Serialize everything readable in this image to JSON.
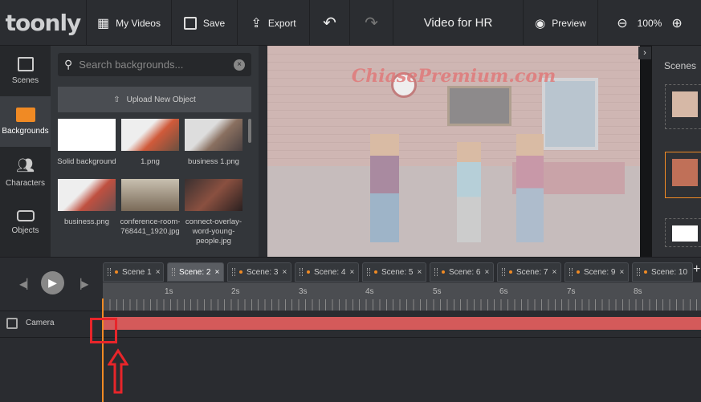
{
  "topbar": {
    "logo": "toonly",
    "my_videos": "My Videos",
    "save": "Save",
    "export": "Export",
    "title": "Video for HR",
    "preview": "Preview",
    "zoom": "100%"
  },
  "sidebar": {
    "items": [
      {
        "label": "Scenes",
        "icon": "scenes-icon"
      },
      {
        "label": "Backgrounds",
        "icon": "backgrounds-icon",
        "active": true
      },
      {
        "label": "Characters",
        "icon": "characters-icon"
      },
      {
        "label": "Objects",
        "icon": "objects-icon"
      }
    ]
  },
  "panel": {
    "search_placeholder": "Search backgrounds...",
    "upload": "Upload New Object",
    "items": [
      {
        "label": "Solid background"
      },
      {
        "label": "1.png"
      },
      {
        "label": "business 1.png"
      },
      {
        "label": "business.png"
      },
      {
        "label": "conference-room-768441_1920.jpg"
      },
      {
        "label": "connect-overlay-word-young-people.jpg"
      }
    ]
  },
  "watermark": "ChiasePremium.com",
  "scenes_panel": {
    "title": "Scenes"
  },
  "timeline": {
    "tabs": [
      "Scene 1",
      "Scene: 2",
      "Scene: 3",
      "Scene: 4",
      "Scene: 5",
      "Scene: 6",
      "Scene: 7",
      "Scene: 9",
      "Scene: 10"
    ],
    "active_tab": 1,
    "ticks": [
      "1s",
      "2s",
      "3s",
      "4s",
      "5s",
      "6s",
      "7s",
      "8s"
    ],
    "track": "Camera"
  },
  "colors": {
    "accent": "#f08a24",
    "track": "#d45a5a",
    "annotation": "#e8252a"
  }
}
